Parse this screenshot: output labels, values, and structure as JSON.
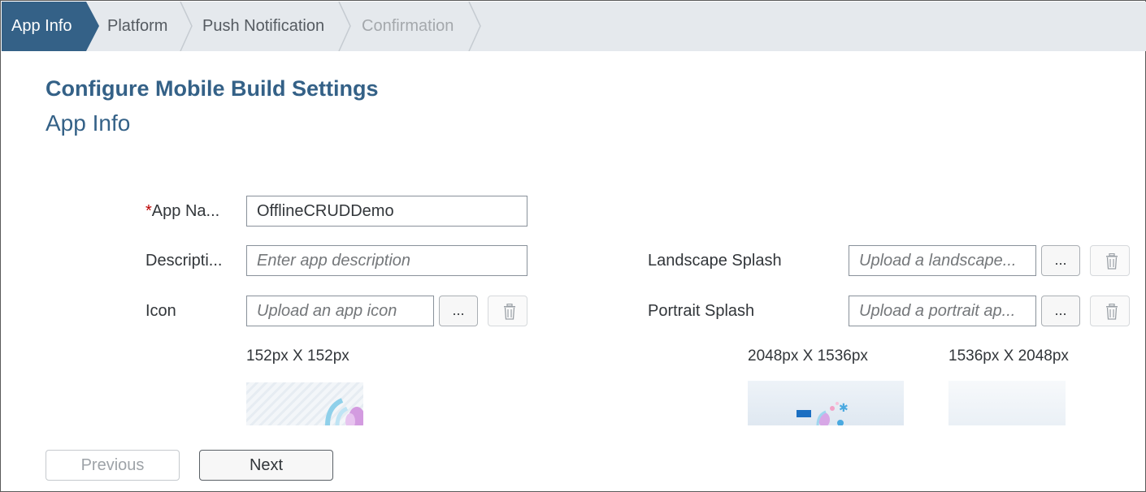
{
  "wizard": {
    "steps": [
      {
        "label": "App Info",
        "state": "active"
      },
      {
        "label": "Platform",
        "state": "done"
      },
      {
        "label": "Push Notification",
        "state": "done"
      },
      {
        "label": "Confirmation",
        "state": "disabled"
      }
    ]
  },
  "page": {
    "title": "Configure Mobile Build Settings",
    "subtitle": "App Info"
  },
  "form": {
    "app_name": {
      "required_mark": "*",
      "label": "App Na...",
      "value": "OfflineCRUDDemo"
    },
    "description": {
      "label": "Descripti...",
      "placeholder": "Enter app description"
    },
    "icon": {
      "label": "Icon",
      "placeholder": "Upload an app icon",
      "browse_label": "...",
      "size_hint": "152px X 152px"
    },
    "landscape_splash": {
      "label": "Landscape Splash",
      "placeholder": "Upload a landscape...",
      "browse_label": "...",
      "size_hint": "2048px X 1536px"
    },
    "portrait_splash": {
      "label": "Portrait Splash",
      "placeholder": "Upload a portrait ap...",
      "browse_label": "...",
      "size_hint": "1536px X 2048px"
    }
  },
  "footer": {
    "previous_label": "Previous",
    "next_label": "Next"
  },
  "colors": {
    "accent": "#346187",
    "active_step": "#346187",
    "stepbar_bg": "#e5e9ed",
    "required": "#bb0000"
  },
  "icons": [
    "trash-icon",
    "ellipsis-icon"
  ]
}
